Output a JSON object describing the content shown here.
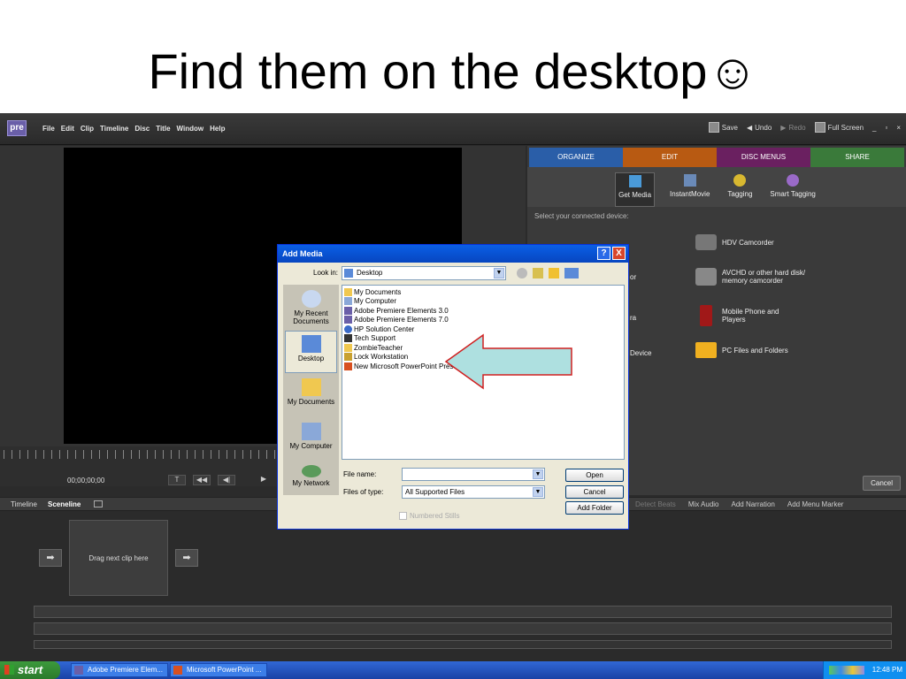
{
  "slide": {
    "title": "Find them on the desktop☺"
  },
  "app": {
    "logo": "pre",
    "menus": [
      "File",
      "Edit",
      "Clip",
      "Timeline",
      "Disc",
      "Title",
      "Window",
      "Help"
    ],
    "toolbar": {
      "save": "Save",
      "undo": "Undo",
      "redo": "Redo",
      "fullscreen": "Full Screen",
      "min": "_",
      "restore": "▫",
      "close": "×"
    },
    "tabs": [
      {
        "label": "ORGANIZE",
        "color": "#2a5ea8"
      },
      {
        "label": "EDIT",
        "color": "#b85a12"
      },
      {
        "label": "DISC MENUS",
        "color": "#6a2060"
      },
      {
        "label": "SHARE",
        "color": "#3a7a3a"
      }
    ],
    "tools": [
      "Get Media",
      "InstantMovie",
      "Tagging",
      "Smart Tagging"
    ],
    "device_prompt": "Select your connected device:",
    "devices": [
      "HDV Camcorder",
      "AVCHD or other hard disk/ memory camcorder",
      "Mobile Phone and Players",
      "PC Files and Folders"
    ],
    "device_partial": [
      "or",
      "ra",
      "Device"
    ],
    "cancel": "Cancel",
    "timecode": "00;00;00;00",
    "timeline_tabs": {
      "timeline": "Timeline",
      "sceneline": "Sceneline"
    },
    "timeline_tools": [
      "Detect Beats",
      "Mix Audio",
      "Add Narration",
      "Add Menu Marker"
    ],
    "drag_clip": "Drag next clip here"
  },
  "dialog": {
    "title": "Add Media",
    "help": "?",
    "close": "X",
    "look_in_label": "Look in:",
    "look_in_value": "Desktop",
    "places": [
      "My Recent Documents",
      "Desktop",
      "My Documents",
      "My Computer",
      "My Network"
    ],
    "files": [
      "My Documents",
      "My Computer",
      "Adobe Premiere Elements 3.0",
      "Adobe Premiere Elements 7.0",
      "HP Solution Center",
      "Tech Support",
      "ZombieTeacher",
      "Lock Workstation",
      "New Microsoft PowerPoint Presentation.ppt"
    ],
    "file_name_label": "File name:",
    "file_name_value": "",
    "files_type_label": "Files of type:",
    "files_type_value": "All Supported Files",
    "open": "Open",
    "cancel": "Cancel",
    "add_folder": "Add Folder",
    "numbered_stills": "Numbered Stills"
  },
  "taskbar": {
    "start": "start",
    "items": [
      "Adobe Premiere Elem...",
      "Microsoft PowerPoint ..."
    ],
    "clock": "12:48 PM"
  }
}
